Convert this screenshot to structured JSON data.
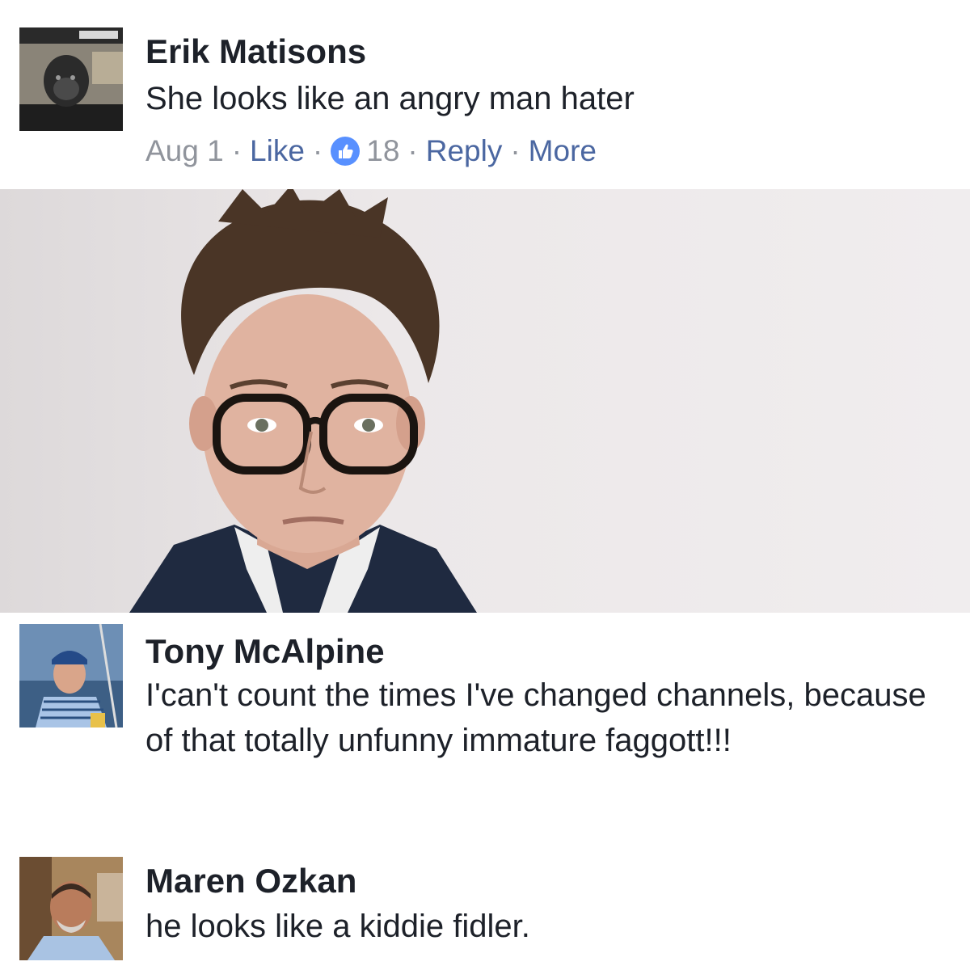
{
  "comments": [
    {
      "author": "Erik Matisons",
      "text": "She looks like an angry man hater",
      "meta": {
        "date": "Aug 1",
        "like_label": "Like",
        "like_count": "18",
        "reply_label": "Reply",
        "more_label": "More"
      }
    },
    {
      "author": "Tony McAlpine",
      "text": "I'can't count the times I've changed channels, because of that totally unfunny immature faggott!!!"
    },
    {
      "author": "Maren Ozkan",
      "text": "he looks like a kiddie fidler."
    }
  ],
  "colors": {
    "name": "#1d2129",
    "meta_gray": "#90949c",
    "link_blue": "#4b67a1",
    "like_badge": "#5890ff"
  },
  "icons": {
    "like_badge": "thumbs-up-icon"
  }
}
